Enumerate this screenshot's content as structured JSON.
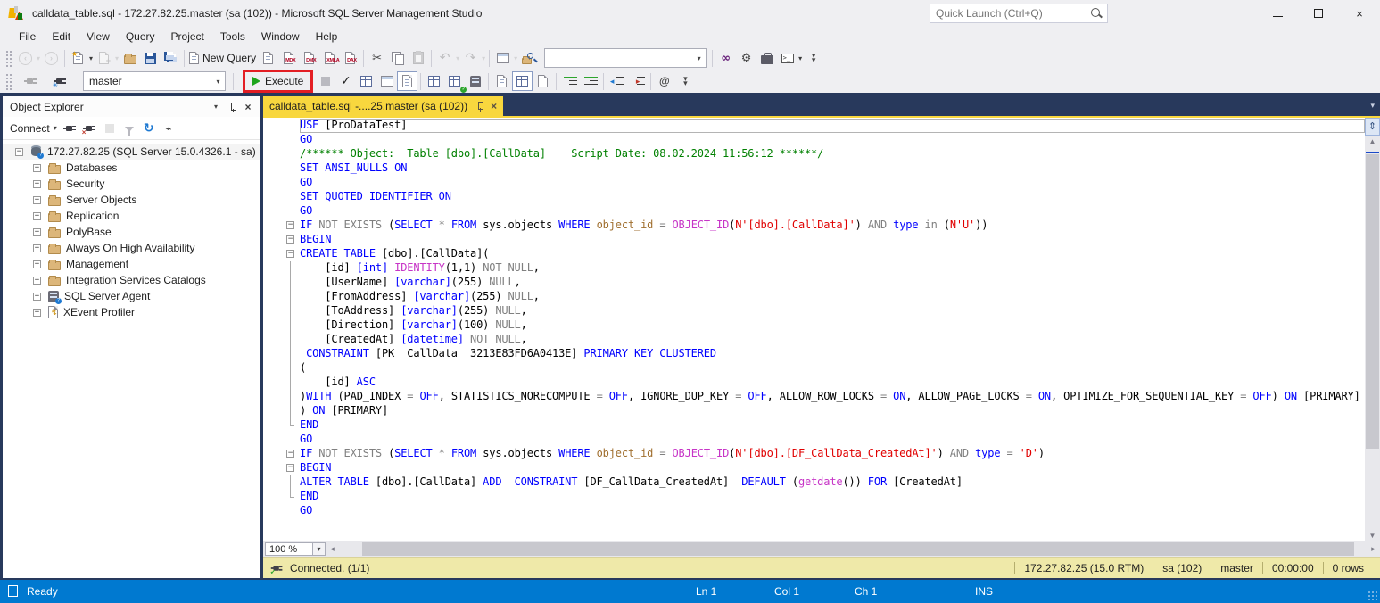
{
  "window": {
    "title": "calldata_table.sql - 172.27.82.25.master (sa (102)) - Microsoft SQL Server Management Studio",
    "quick_launch_placeholder": "Quick Launch (Ctrl+Q)"
  },
  "menus": [
    "File",
    "Edit",
    "View",
    "Query",
    "Project",
    "Tools",
    "Window",
    "Help"
  ],
  "icons": {
    "undo": "↶",
    "redo": "↷",
    "refresh": "↻",
    "scissors": "✂",
    "check": "✓",
    "close": "×",
    "caret_down": "▾",
    "vs_logo": "∞",
    "gear": "⚙",
    "pulse": "⌁",
    "up_arrow": "▲",
    "down_arrow": "▼",
    "left_arrow": "◂",
    "right_arrow": "▸",
    "nav_back": "‹",
    "nav_forward": "›",
    "splitter": "⇕",
    "at": "@",
    "console_prompt": ">_",
    "overflow": "▾▾",
    "lightning": "↯"
  },
  "toolbar1": {
    "new_query_label": "New Query",
    "query_types": [
      "MDX",
      "DMX",
      "XMLA",
      "DAX"
    ]
  },
  "toolbar2": {
    "database": "master",
    "execute_label": "Execute",
    "highlight_color": "#E31E24"
  },
  "object_explorer": {
    "title": "Object Explorer",
    "connect_label": "Connect",
    "server_label": "172.27.82.25 (SQL Server 15.0.4326.1 - sa)",
    "items": [
      {
        "icon": "folder",
        "label": "Databases"
      },
      {
        "icon": "folder",
        "label": "Security"
      },
      {
        "icon": "folder",
        "label": "Server Objects"
      },
      {
        "icon": "folder",
        "label": "Replication"
      },
      {
        "icon": "folder",
        "label": "PolyBase"
      },
      {
        "icon": "folder",
        "label": "Always On High Availability"
      },
      {
        "icon": "folder",
        "label": "Management"
      },
      {
        "icon": "folder",
        "label": "Integration Services Catalogs"
      },
      {
        "icon": "agent",
        "label": "SQL Server Agent"
      },
      {
        "icon": "xevent",
        "label": "XEvent Profiler"
      }
    ]
  },
  "editor": {
    "tab_label": "calldata_table.sql -....25.master (sa (102))",
    "zoom_level": "100 %",
    "syntax_colors": {
      "keyword": "#0000FF",
      "text": "#000000",
      "comment": "#008000",
      "operator": "#808080",
      "string": "#E00000",
      "function": "#C735C7",
      "column": "#A06F2F"
    },
    "code_lines": [
      {
        "o": "none",
        "cur": true,
        "seg": [
          [
            "k",
            "USE"
          ],
          [
            "t",
            " [ProDataTest]"
          ]
        ]
      },
      {
        "o": "none",
        "seg": [
          [
            "k",
            "GO"
          ]
        ]
      },
      {
        "o": "none",
        "seg": [
          [
            "c",
            "/****** Object:  Table [dbo].[CallData]    Script Date: 08.02.2024 11:56:12 ******/"
          ]
        ]
      },
      {
        "o": "none",
        "seg": [
          [
            "k",
            "SET ANSI_NULLS ON"
          ]
        ]
      },
      {
        "o": "none",
        "seg": [
          [
            "k",
            "GO"
          ]
        ]
      },
      {
        "o": "none",
        "seg": [
          [
            "k",
            "SET QUOTED_IDENTIFIER ON"
          ]
        ]
      },
      {
        "o": "none",
        "seg": [
          [
            "k",
            "GO"
          ]
        ]
      },
      {
        "o": "start",
        "seg": [
          [
            "k",
            "IF"
          ],
          [
            "g",
            " NOT EXISTS "
          ],
          [
            "t",
            "("
          ],
          [
            "k",
            "SELECT"
          ],
          [
            "g",
            " * "
          ],
          [
            "k",
            "FROM"
          ],
          [
            "t",
            " sys.objects "
          ],
          [
            "k",
            "WHERE"
          ],
          [
            "o",
            " object_id "
          ],
          [
            "g",
            "="
          ],
          [
            "t",
            " "
          ],
          [
            "f",
            "OBJECT_ID"
          ],
          [
            "t",
            "("
          ],
          [
            "s",
            "N'[dbo].[CallData]'"
          ],
          [
            "t",
            ") "
          ],
          [
            "g",
            "AND"
          ],
          [
            "t",
            " "
          ],
          [
            "k",
            "type"
          ],
          [
            "t",
            " "
          ],
          [
            "g",
            "in"
          ],
          [
            "t",
            " ("
          ],
          [
            "s",
            "N'U'"
          ],
          [
            "t",
            "))"
          ]
        ]
      },
      {
        "o": "start",
        "seg": [
          [
            "k",
            "BEGIN"
          ]
        ]
      },
      {
        "o": "start",
        "seg": [
          [
            "k",
            "CREATE TABLE"
          ],
          [
            "t",
            " [dbo].[CallData]("
          ]
        ]
      },
      {
        "o": "line",
        "seg": [
          [
            "t",
            "    [id] "
          ],
          [
            "k",
            "[int]"
          ],
          [
            "t",
            " "
          ],
          [
            "f",
            "IDENTITY"
          ],
          [
            "t",
            "(1,1) "
          ],
          [
            "g",
            "NOT NULL"
          ],
          [
            "t",
            ","
          ]
        ]
      },
      {
        "o": "line",
        "seg": [
          [
            "t",
            "    [UserName] "
          ],
          [
            "k",
            "[varchar]"
          ],
          [
            "t",
            "(255) "
          ],
          [
            "g",
            "NULL"
          ],
          [
            "t",
            ","
          ]
        ]
      },
      {
        "o": "line",
        "seg": [
          [
            "t",
            "    [FromAddress] "
          ],
          [
            "k",
            "[varchar]"
          ],
          [
            "t",
            "(255) "
          ],
          [
            "g",
            "NULL"
          ],
          [
            "t",
            ","
          ]
        ]
      },
      {
        "o": "line",
        "seg": [
          [
            "t",
            "    [ToAddress] "
          ],
          [
            "k",
            "[varchar]"
          ],
          [
            "t",
            "(255) "
          ],
          [
            "g",
            "NULL"
          ],
          [
            "t",
            ","
          ]
        ]
      },
      {
        "o": "line",
        "seg": [
          [
            "t",
            "    [Direction] "
          ],
          [
            "k",
            "[varchar]"
          ],
          [
            "t",
            "(100) "
          ],
          [
            "g",
            "NULL"
          ],
          [
            "t",
            ","
          ]
        ]
      },
      {
        "o": "line",
        "seg": [
          [
            "t",
            "    [CreatedAt] "
          ],
          [
            "k",
            "[datetime]"
          ],
          [
            "t",
            " "
          ],
          [
            "g",
            "NOT NULL"
          ],
          [
            "t",
            ","
          ]
        ]
      },
      {
        "o": "line",
        "seg": [
          [
            "t",
            " "
          ],
          [
            "k",
            "CONSTRAINT"
          ],
          [
            "t",
            " [PK__CallData__3213E83FD6A0413E] "
          ],
          [
            "k",
            "PRIMARY KEY CLUSTERED"
          ],
          [
            "t",
            " "
          ]
        ]
      },
      {
        "o": "line",
        "seg": [
          [
            "t",
            "("
          ]
        ]
      },
      {
        "o": "line",
        "seg": [
          [
            "t",
            "    [id] "
          ],
          [
            "k",
            "ASC"
          ]
        ]
      },
      {
        "o": "line",
        "seg": [
          [
            "t",
            ")"
          ],
          [
            "k",
            "WITH"
          ],
          [
            "t",
            " (PAD_INDEX "
          ],
          [
            "g",
            "="
          ],
          [
            "t",
            " "
          ],
          [
            "k",
            "OFF"
          ],
          [
            "t",
            ", STATISTICS_NORECOMPUTE "
          ],
          [
            "g",
            "="
          ],
          [
            "t",
            " "
          ],
          [
            "k",
            "OFF"
          ],
          [
            "t",
            ", IGNORE_DUP_KEY "
          ],
          [
            "g",
            "="
          ],
          [
            "t",
            " "
          ],
          [
            "k",
            "OFF"
          ],
          [
            "t",
            ", ALLOW_ROW_LOCKS "
          ],
          [
            "g",
            "="
          ],
          [
            "t",
            " "
          ],
          [
            "k",
            "ON"
          ],
          [
            "t",
            ", ALLOW_PAGE_LOCKS "
          ],
          [
            "g",
            "="
          ],
          [
            "t",
            " "
          ],
          [
            "k",
            "ON"
          ],
          [
            "t",
            ", OPTIMIZE_FOR_SEQUENTIAL_KEY "
          ],
          [
            "g",
            "="
          ],
          [
            "t",
            " "
          ],
          [
            "k",
            "OFF"
          ],
          [
            "t",
            ") "
          ],
          [
            "k",
            "ON"
          ],
          [
            "t",
            " [PRIMARY]"
          ]
        ]
      },
      {
        "o": "line",
        "seg": [
          [
            "t",
            ") "
          ],
          [
            "k",
            "ON"
          ],
          [
            "t",
            " [PRIMARY]"
          ]
        ]
      },
      {
        "o": "end",
        "seg": [
          [
            "k",
            "END"
          ]
        ]
      },
      {
        "o": "none",
        "seg": [
          [
            "k",
            "GO"
          ]
        ]
      },
      {
        "o": "start",
        "seg": [
          [
            "k",
            "IF"
          ],
          [
            "g",
            " NOT EXISTS "
          ],
          [
            "t",
            "("
          ],
          [
            "k",
            "SELECT"
          ],
          [
            "g",
            " * "
          ],
          [
            "k",
            "FROM"
          ],
          [
            "t",
            " sys.objects "
          ],
          [
            "k",
            "WHERE"
          ],
          [
            "o",
            " object_id "
          ],
          [
            "g",
            "="
          ],
          [
            "t",
            " "
          ],
          [
            "f",
            "OBJECT_ID"
          ],
          [
            "t",
            "("
          ],
          [
            "s",
            "N'[dbo].[DF_CallData_CreatedAt]'"
          ],
          [
            "t",
            ") "
          ],
          [
            "g",
            "AND"
          ],
          [
            "t",
            " "
          ],
          [
            "k",
            "type"
          ],
          [
            "t",
            " "
          ],
          [
            "g",
            "="
          ],
          [
            "t",
            " "
          ],
          [
            "s",
            "'D'"
          ],
          [
            "t",
            ")"
          ]
        ]
      },
      {
        "o": "start",
        "seg": [
          [
            "k",
            "BEGIN"
          ]
        ]
      },
      {
        "o": "line",
        "seg": [
          [
            "k",
            "ALTER TABLE"
          ],
          [
            "t",
            " [dbo].[CallData] "
          ],
          [
            "k",
            "ADD"
          ],
          [
            "t",
            "  "
          ],
          [
            "k",
            "CONSTRAINT"
          ],
          [
            "t",
            " [DF_CallData_CreatedAt]  "
          ],
          [
            "k",
            "DEFAULT"
          ],
          [
            "t",
            " ("
          ],
          [
            "f",
            "getdate"
          ],
          [
            "t",
            "()) "
          ],
          [
            "k",
            "FOR"
          ],
          [
            "t",
            " [CreatedAt]"
          ]
        ]
      },
      {
        "o": "end",
        "seg": [
          [
            "k",
            "END"
          ]
        ]
      },
      {
        "o": "none",
        "seg": [
          [
            "k",
            "GO"
          ]
        ]
      }
    ]
  },
  "status_strip": {
    "connected": "Connected. (1/1)",
    "segments": [
      "172.27.82.25 (15.0 RTM)",
      "sa (102)",
      "master",
      "00:00:00",
      "0 rows"
    ]
  },
  "status_bar": {
    "ready": "Ready",
    "ln": "Ln 1",
    "col": "Col 1",
    "ch": "Ch 1",
    "ins": "INS"
  }
}
